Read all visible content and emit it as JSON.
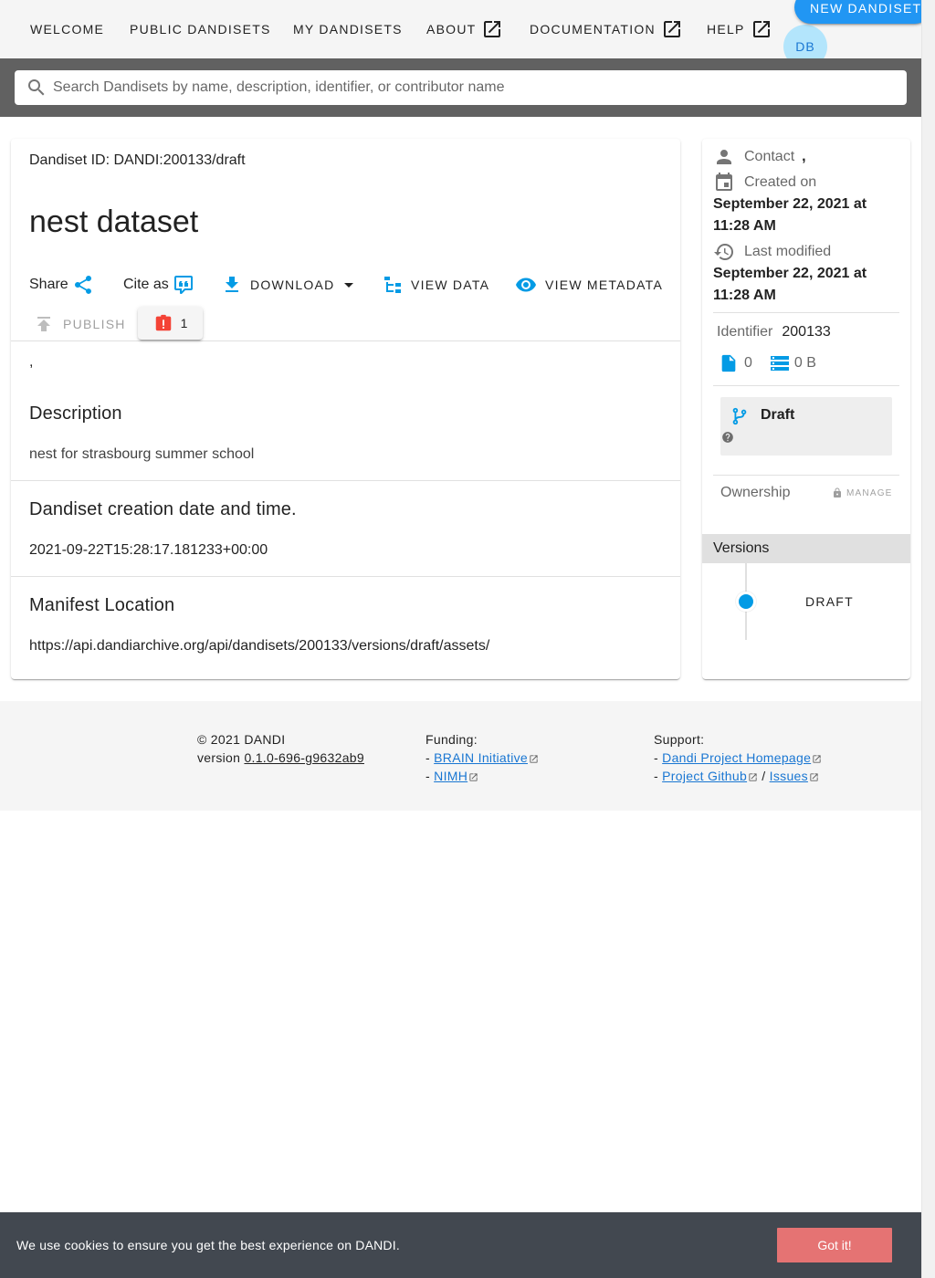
{
  "nav": {
    "items": [
      {
        "label": "WELCOME"
      },
      {
        "label": "PUBLIC DANDISETS"
      },
      {
        "label": "MY DANDISETS"
      },
      {
        "label": "ABOUT"
      },
      {
        "label": "DOCUMENTATION"
      },
      {
        "label": "HELP"
      }
    ],
    "new_button": "NEW DANDISET",
    "avatar_initials": "DB"
  },
  "search": {
    "placeholder": "Search Dandisets by name, description, identifier, or contributor name",
    "value": ""
  },
  "dandiset": {
    "id_label": "Dandiset ID: DANDI:200133/draft",
    "title": "nest dataset",
    "actions": {
      "share": "Share",
      "cite": "Cite as",
      "download": "DOWNLOAD",
      "view_data": "VIEW DATA",
      "view_metadata": "VIEW METADATA",
      "publish": "PUBLISH",
      "validation_count": "1"
    },
    "contributors_line": ",",
    "sections": [
      {
        "title": "Description",
        "text": "nest for strasbourg summer school"
      },
      {
        "title": "Dandiset creation date and time.",
        "text": "2021-09-22T15:28:17.181233+00:00"
      },
      {
        "title": "Manifest Location",
        "text": "https://api.dandiarchive.org/api/dandisets/200133/versions/draft/assets/"
      }
    ]
  },
  "sidebar": {
    "contact_label": "Contact",
    "contact_value": ",",
    "created_label": "Created on",
    "created_value": "September 22, 2021 at 11:28 AM",
    "modified_label": "Last modified",
    "modified_value": "September 22, 2021 at 11:28 AM",
    "identifier_label": "Identifier",
    "identifier_value": "200133",
    "file_count": "0",
    "size": "0 B",
    "version_status": "Draft",
    "ownership_label": "Ownership",
    "manage_label": "MANAGE",
    "versions_header": "Versions",
    "versions": [
      {
        "label": "DRAFT"
      }
    ]
  },
  "footer": {
    "copyright": "© 2021 DANDI",
    "version_prefix": "version",
    "version": "0.1.0-696-g9632ab9",
    "funding_label": "Funding:",
    "funding_links": [
      "BRAIN Initiative",
      "NIMH"
    ],
    "support_label": "Support:",
    "support_links": [
      "Dandi Project Homepage",
      "Project Github",
      "Issues"
    ]
  },
  "cookie": {
    "message": "We use cookies to ensure you get the best experience on DANDI.",
    "button": "Got it!"
  },
  "colors": {
    "accent": "#2196f3",
    "icon_blue": "#039be5",
    "error_red": "#f44336",
    "cookie_bg": "#424850",
    "cookie_btn": "#e57373"
  }
}
